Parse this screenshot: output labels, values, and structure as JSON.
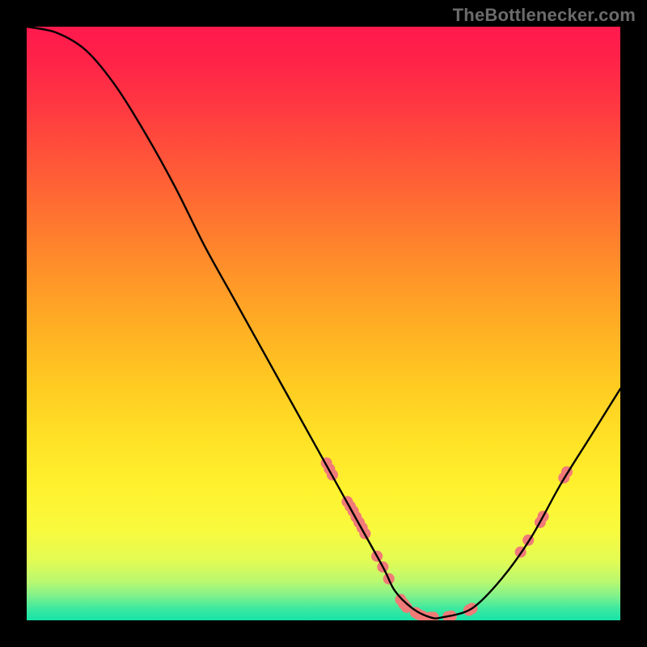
{
  "watermark": "TheBottlenecker.com",
  "chart_data": {
    "type": "line",
    "title": "",
    "xlabel": "",
    "ylabel": "",
    "xlim": [
      0,
      100
    ],
    "ylim": [
      0,
      100
    ],
    "curve": {
      "x": [
        0,
        5,
        10,
        15,
        20,
        25,
        30,
        35,
        40,
        45,
        50,
        55,
        60,
        62,
        65,
        68,
        70,
        75,
        80,
        85,
        90,
        95,
        100
      ],
      "y": [
        100,
        99,
        96,
        90,
        82,
        73,
        63,
        54,
        45,
        36,
        27,
        18,
        9,
        5,
        2,
        0.5,
        0.5,
        2,
        7,
        14,
        23,
        31,
        39
      ]
    },
    "points": [
      {
        "x": 50.5,
        "y": 26.5
      },
      {
        "x": 51,
        "y": 25.5
      },
      {
        "x": 51.5,
        "y": 24.5
      },
      {
        "x": 54,
        "y": 20
      },
      {
        "x": 54.5,
        "y": 19.2
      },
      {
        "x": 55,
        "y": 18.4
      },
      {
        "x": 55.5,
        "y": 17.4
      },
      {
        "x": 56,
        "y": 16.5
      },
      {
        "x": 56.5,
        "y": 15.6
      },
      {
        "x": 57,
        "y": 14.6
      },
      {
        "x": 59,
        "y": 10.8
      },
      {
        "x": 60,
        "y": 9
      },
      {
        "x": 61,
        "y": 7
      },
      {
        "x": 63,
        "y": 3.5
      },
      {
        "x": 63.5,
        "y": 2.8
      },
      {
        "x": 64,
        "y": 2.2
      },
      {
        "x": 65.5,
        "y": 1.3
      },
      {
        "x": 66,
        "y": 1.0
      },
      {
        "x": 66.7,
        "y": 0.7
      },
      {
        "x": 68,
        "y": 0.5
      },
      {
        "x": 68.5,
        "y": 0.5
      },
      {
        "x": 71,
        "y": 0.6
      },
      {
        "x": 71.5,
        "y": 0.7
      },
      {
        "x": 74.5,
        "y": 1.7
      },
      {
        "x": 75,
        "y": 2.0
      },
      {
        "x": 83.2,
        "y": 11.5
      },
      {
        "x": 84.5,
        "y": 13.5
      },
      {
        "x": 86.5,
        "y": 16.5
      },
      {
        "x": 87,
        "y": 17.5
      },
      {
        "x": 90.5,
        "y": 24
      },
      {
        "x": 91,
        "y": 25
      }
    ],
    "gradient_stops": [
      {
        "offset": 0.0,
        "color": "#ff1a4d"
      },
      {
        "offset": 0.05,
        "color": "#ff2149"
      },
      {
        "offset": 0.12,
        "color": "#ff3443"
      },
      {
        "offset": 0.2,
        "color": "#ff4d3b"
      },
      {
        "offset": 0.3,
        "color": "#ff6d32"
      },
      {
        "offset": 0.4,
        "color": "#ff8e2a"
      },
      {
        "offset": 0.5,
        "color": "#ffad24"
      },
      {
        "offset": 0.6,
        "color": "#ffca22"
      },
      {
        "offset": 0.7,
        "color": "#ffe326"
      },
      {
        "offset": 0.78,
        "color": "#fff22f"
      },
      {
        "offset": 0.85,
        "color": "#f8fa3e"
      },
      {
        "offset": 0.9,
        "color": "#e2fb54"
      },
      {
        "offset": 0.935,
        "color": "#b9f870"
      },
      {
        "offset": 0.96,
        "color": "#7df18c"
      },
      {
        "offset": 0.98,
        "color": "#3de99f"
      },
      {
        "offset": 1.0,
        "color": "#17e3a8"
      }
    ],
    "point_style": {
      "color": "#f07a78",
      "radius": 7
    },
    "line_style": {
      "color": "#000000",
      "width": 2.4
    }
  }
}
